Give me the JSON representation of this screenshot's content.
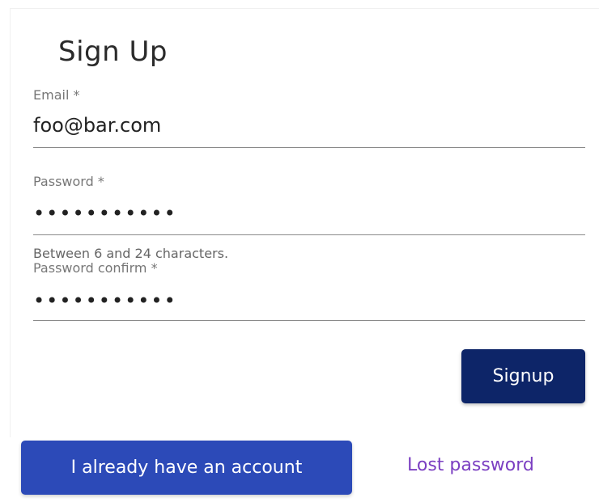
{
  "form": {
    "title": "Sign Up",
    "email": {
      "label": "Email *",
      "value": "foo@bar.com"
    },
    "password": {
      "label": "Password *",
      "value": "•••••••••••",
      "helper": "Between 6 and 24 characters."
    },
    "password_confirm": {
      "label": "Password confirm *",
      "value": "•••••••••••"
    },
    "signup_label": "Signup"
  },
  "footer": {
    "login_label": "I already have an account",
    "lost_password_label": "Lost password"
  },
  "colors": {
    "signup_button": "#0d2568",
    "login_button": "#2c4ab8",
    "link": "#7b3fc2"
  }
}
